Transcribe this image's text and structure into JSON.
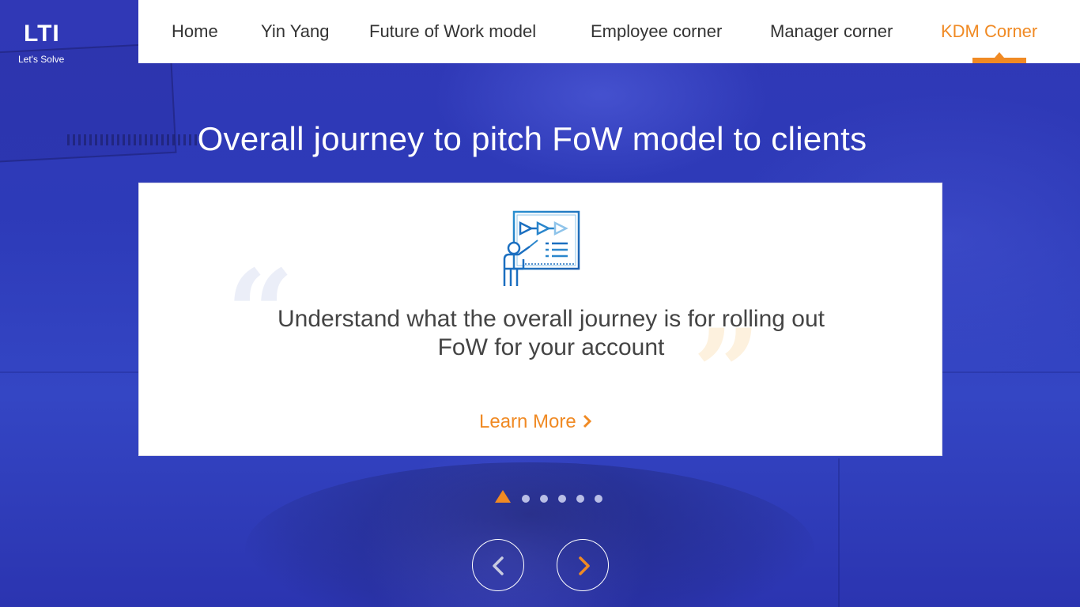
{
  "brand": {
    "logo_text": "LTI",
    "tagline": "Let's Solve"
  },
  "nav": {
    "items": [
      {
        "label": "Home",
        "active": false
      },
      {
        "label": "Yin Yang",
        "active": false
      },
      {
        "label": "Future of Work model",
        "active": false
      },
      {
        "label": "Employee corner",
        "active": false
      },
      {
        "label": "Manager corner",
        "active": false
      },
      {
        "label": "KDM Corner",
        "active": true
      }
    ]
  },
  "hero": {
    "title": "Overall journey to pitch FoW model to clients"
  },
  "card": {
    "icon": "presentation-icon",
    "text": "Understand what the overall journey is for rolling out FoW for your account",
    "link_label": "Learn More"
  },
  "pager": {
    "total": 6,
    "current": 1
  },
  "controls": {
    "prev_icon": "chevron-left-icon",
    "next_icon": "chevron-right-icon"
  },
  "colors": {
    "accent": "#f08a24",
    "background": "#2f37b8",
    "icon_blue": "#2a8fd0"
  }
}
